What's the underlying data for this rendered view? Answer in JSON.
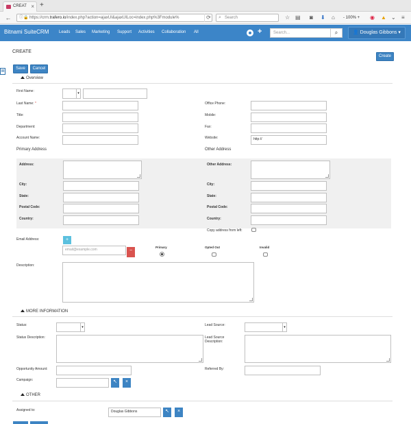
{
  "browser": {
    "tab_title": "CREAT",
    "tab_close": "×",
    "new_tab": "+",
    "back": "←",
    "url_prefix": "https://crm.",
    "url_domain": "trafero.io",
    "url_rest": "/index.php?action=ajaxUI&ajaxUILoc=index.php%3Fmodule%",
    "reload": "⟳",
    "search_placeholder": "Search",
    "zoom": "- 100% +"
  },
  "app": {
    "brand": "Bitnami SuiteCRM",
    "menu": [
      "Leads",
      "Sales",
      "Marketing",
      "Support",
      "Activities",
      "Collaboration",
      "All"
    ],
    "plus": "+",
    "search_placeholder": "Search...",
    "search_icon": "search-icon",
    "user_name": "Douglas Gibbons",
    "user_caret": "▾"
  },
  "page": {
    "title": "CREATE",
    "create_button": "Create",
    "save_button": "Save",
    "cancel_button": "Cancel"
  },
  "overview": {
    "title": "Overview",
    "first_name": "First Name:",
    "last_name": "Last Name:",
    "required_mark": "*",
    "title_label": "Title:",
    "department": "Department:",
    "account_name": "Account Name:",
    "office_phone": "Office Phone:",
    "mobile": "Mobile:",
    "fax": "Fax:",
    "website": "Website:",
    "website_value": "http://"
  },
  "primary_address": {
    "heading": "Primary Address",
    "address": "Address:",
    "city": "City:",
    "state": "State:",
    "postal_code": "Postal Code:",
    "country": "Country:"
  },
  "other_address": {
    "heading": "Other Address",
    "address": "Other Address:",
    "city": "City:",
    "state": "State:",
    "postal_code": "Postal Code:",
    "country": "Country:",
    "copy_label": "Copy address from left:"
  },
  "email": {
    "label": "Email Address:",
    "add": "+",
    "remove": "−",
    "placeholder": "email@example.com",
    "primary": "Primary",
    "opted_out": "Opted Out",
    "invalid": "Invalid"
  },
  "description": {
    "label": "Description:"
  },
  "more_info": {
    "title": "MORE INFORMATION",
    "status": "Status:",
    "status_description": "Status Description:",
    "opportunity_amount": "Opportunity Amount:",
    "campaign": "Campaign:",
    "lead_source": "Lead Source:",
    "lead_source_description_1": "Lead Source",
    "lead_source_description_2": "Description:",
    "referred_by": "Referred By:",
    "select_arrow": "↖",
    "clear": "×"
  },
  "other": {
    "title": "OTHER",
    "assigned_to": "Assigned to:",
    "assigned_value": "Douglas Gibbons",
    "select_arrow": "↖",
    "clear": "×"
  },
  "colors": {
    "brand_blue": "#3c85c8",
    "button_blue": "#3d84c3",
    "danger_red": "#d9534f",
    "add_blue": "#5bc0de"
  }
}
